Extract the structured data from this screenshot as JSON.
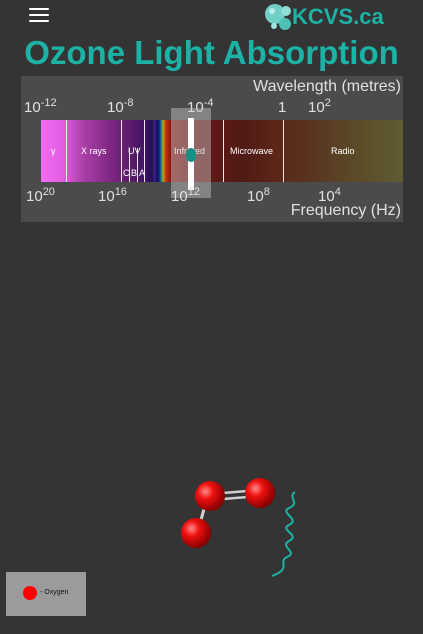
{
  "header": {
    "menu_icon": "hamburger-menu-icon",
    "logo_text": "KCVS.ca",
    "logo_icon": "kcvs-bubbles-icon"
  },
  "title": "Ozone Light Absorption",
  "spectrum": {
    "wavelength_label": "Wavelength (metres)",
    "frequency_label": "Frequency (Hz)",
    "wavelength_ticks": [
      {
        "base": "10",
        "exp": "-12"
      },
      {
        "base": "10",
        "exp": "-8"
      },
      {
        "base": "10",
        "exp": "-4"
      },
      {
        "base": "1",
        "exp": ""
      },
      {
        "base": "10",
        "exp": "2"
      }
    ],
    "frequency_ticks": [
      {
        "base": "10",
        "exp": "20"
      },
      {
        "base": "10",
        "exp": "16"
      },
      {
        "base": "10",
        "exp": "12"
      },
      {
        "base": "10",
        "exp": "8"
      },
      {
        "base": "10",
        "exp": "4"
      }
    ],
    "bands": {
      "gamma": "γ",
      "xrays": "X rays",
      "uv": "UV",
      "uv_c": "C",
      "uv_b": "B",
      "uv_a": "A",
      "infrared": "Infrared",
      "microwave": "Microwave",
      "radio": "Radio"
    },
    "selected_band": "Infrared"
  },
  "legend": {
    "oxygen_label": "- Oxygen",
    "oxygen_color": "#ff0000"
  },
  "colors": {
    "accent": "#1cb2a6",
    "background": "#343434"
  }
}
